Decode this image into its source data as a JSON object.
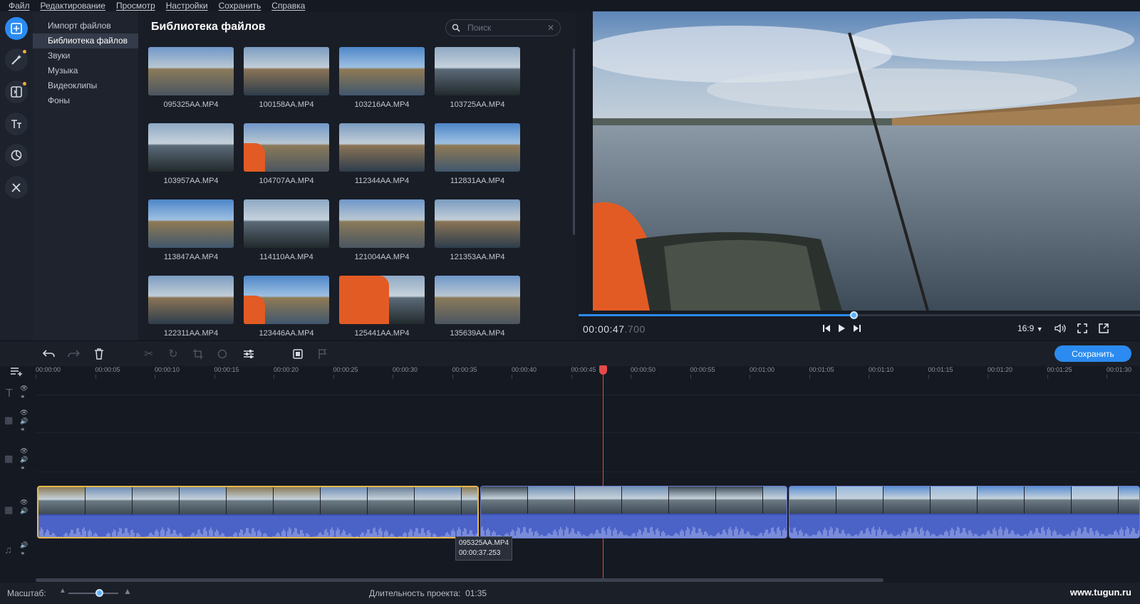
{
  "menu": [
    "Файл",
    "Редактирование",
    "Просмотр",
    "Настройки",
    "Сохранить",
    "Справка"
  ],
  "rail": {
    "buttons": [
      {
        "icon": "import-icon",
        "active": true,
        "dot": false
      },
      {
        "icon": "magic-wand-icon",
        "active": false,
        "dot": true
      },
      {
        "icon": "transitions-icon",
        "active": false,
        "dot": true
      },
      {
        "icon": "titles-icon",
        "active": false,
        "dot": false
      },
      {
        "icon": "stickers-icon",
        "active": false,
        "dot": false
      },
      {
        "icon": "tools-icon",
        "active": false,
        "dot": false
      }
    ]
  },
  "sidenav": {
    "items": [
      "Импорт файлов",
      "Библиотека файлов",
      "Звуки",
      "Музыка",
      "Видеоклипы",
      "Фоны"
    ],
    "active_index": 1
  },
  "library": {
    "title": "Библиотека файлов",
    "search_placeholder": "Поиск",
    "files": [
      "095325AA.MP4",
      "100158AA.MP4",
      "103216AA.MP4",
      "103725AA.MP4",
      "103957AA.MP4",
      "104707AA.MP4",
      "112344AA.MP4",
      "112831AA.MP4",
      "113847AA.MP4",
      "114110AA.MP4",
      "121004AA.MP4",
      "121353AA.MP4",
      "122311AA.MP4",
      "123446AA.MP4",
      "125441AA.MP4",
      "135639AA.MP4"
    ]
  },
  "preview": {
    "timecode_main": "00:00:47",
    "timecode_ms": ".700",
    "progress": 0.49,
    "aspect_ratio": "16:9"
  },
  "toolbar": {
    "save_label": "Сохранить"
  },
  "timeline": {
    "ruler": [
      "00:00:00",
      "00:00:05",
      "00:00:10",
      "00:00:15",
      "00:00:20",
      "00:00:25",
      "00:00:30",
      "00:00:35",
      "00:00:40",
      "00:00:45",
      "00:00:50",
      "00:00:55",
      "00:01:00",
      "00:01:05",
      "00:01:10",
      "00:01:15",
      "00:01:20",
      "00:01:25",
      "00:01:30"
    ],
    "tooltip_name": "095325AA.MP4",
    "tooltip_duration": "00:00:37.253"
  },
  "status": {
    "zoom_label": "Масштаб:",
    "duration_label": "Длительность проекта:",
    "duration_value": "01:35",
    "watermark": "www.tugun.ru"
  },
  "colors": {
    "accent": "#2b8bf0",
    "playhead": "#e34b4b",
    "selection": "#e8b94a",
    "audio": "#4b62c7"
  }
}
